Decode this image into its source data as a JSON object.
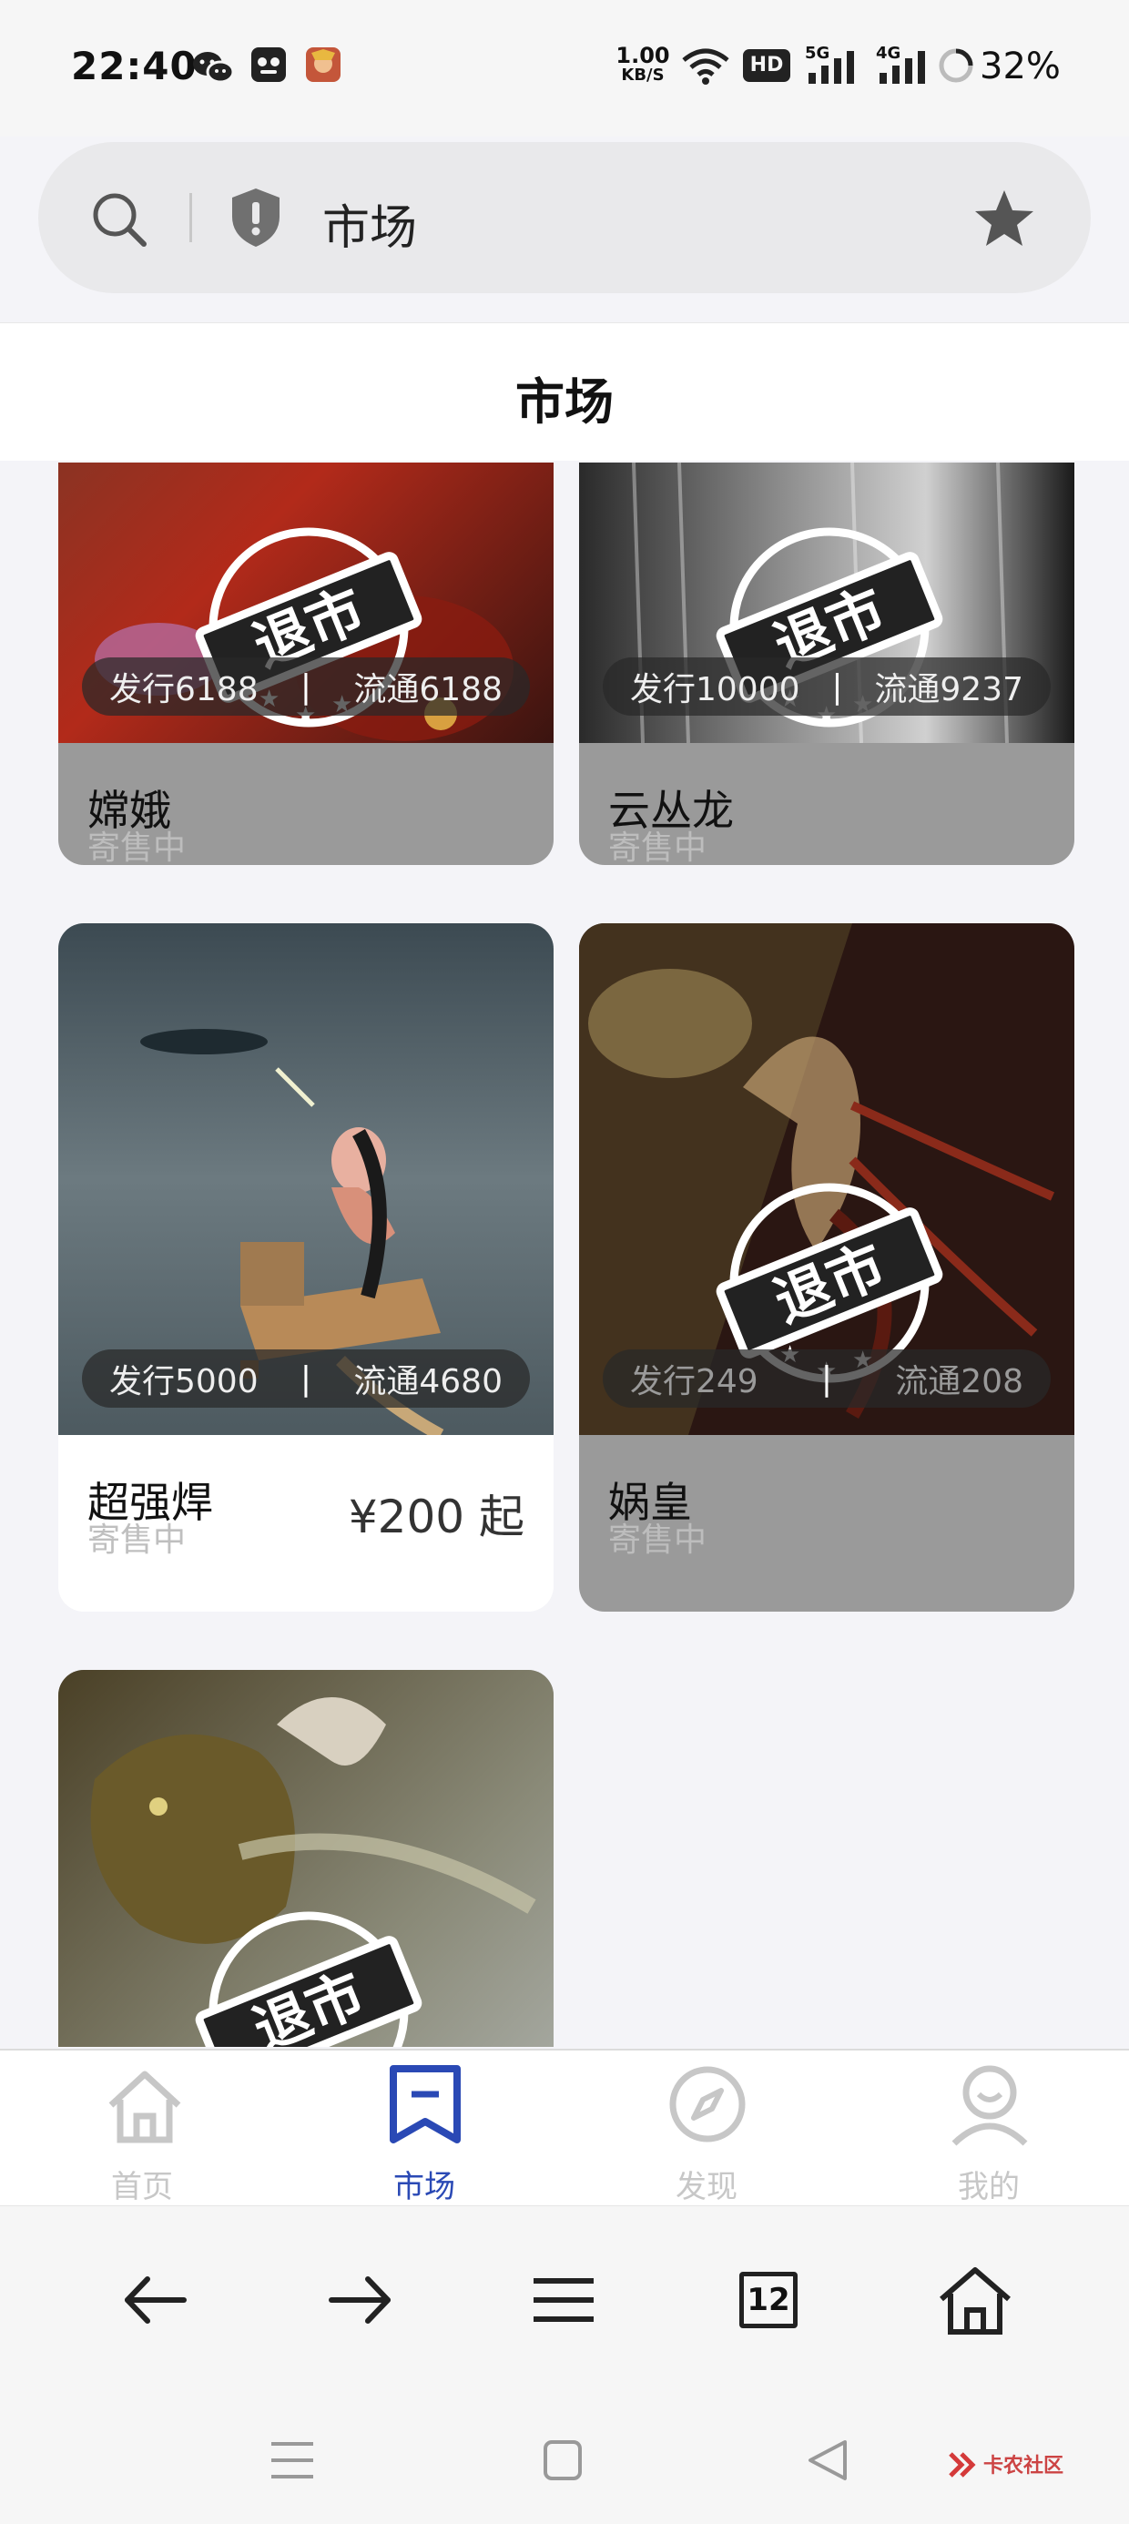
{
  "status_bar": {
    "time": "22:40",
    "net_speed_value": "1.00",
    "net_speed_unit": "KB/S",
    "hd_label": "HD",
    "sim1_label": "5G",
    "sim2_label": "4G",
    "battery": "32%"
  },
  "address_bar": {
    "title": "市场"
  },
  "page": {
    "title": "市场"
  },
  "cards": [
    {
      "name": "嫦娥",
      "status": "寄售中",
      "issue": "发行6188",
      "circulation": "流通6188",
      "stamp_text": "退市",
      "delisted": true
    },
    {
      "name": "云丛龙",
      "status": "寄售中",
      "issue": "发行10000",
      "circulation": "流通9237",
      "stamp_text": "退市",
      "delisted": true
    },
    {
      "name": "超强焊",
      "status": "寄售中",
      "issue": "发行5000",
      "circulation": "流通4680",
      "price": "¥200 起",
      "delisted": false
    },
    {
      "name": "娲皇",
      "status": "寄售中",
      "issue": "发行249",
      "circulation": "流通208",
      "stamp_text": "退市",
      "delisted": true
    },
    {
      "stamp_text": "退市",
      "delisted": true
    }
  ],
  "pill_separator": "|",
  "tabs": [
    {
      "label": "首页",
      "icon": "home-icon",
      "active": false
    },
    {
      "label": "市场",
      "icon": "bookmark-icon",
      "active": true
    },
    {
      "label": "发现",
      "icon": "compass-icon",
      "active": false
    },
    {
      "label": "我的",
      "icon": "profile-icon",
      "active": false
    }
  ],
  "browser_toolbar": {
    "tab_count": "12"
  },
  "watermark": "卡农社区",
  "colors": {
    "accent": "#2a49b5",
    "inactive_tab": "#c7c7c7",
    "dim_card": "#9a9a9a"
  }
}
